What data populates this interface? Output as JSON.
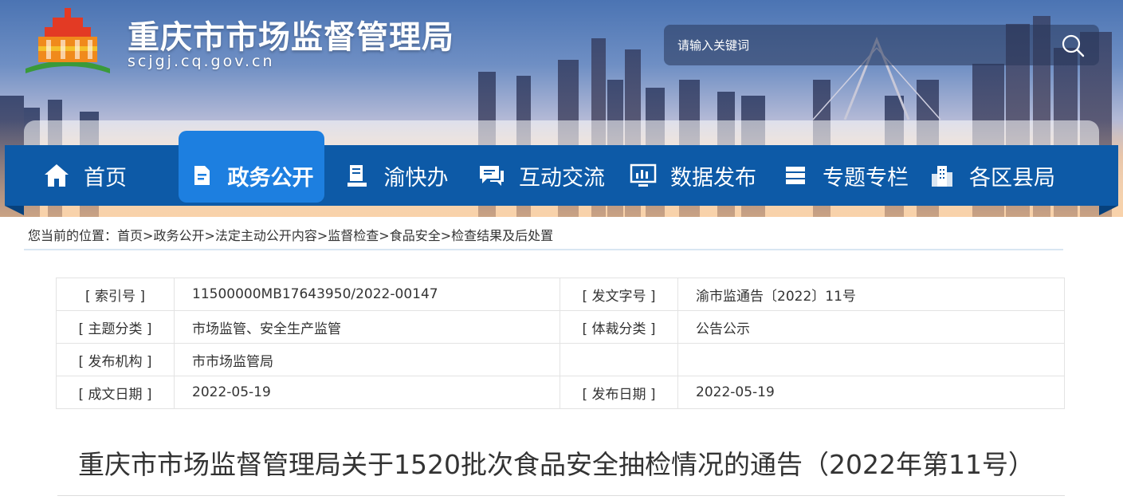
{
  "header": {
    "site_title": "重庆市市场监督管理局",
    "site_domain": "scjgj.cq.gov.cn",
    "search": {
      "placeholder": "请输入关键词",
      "icon": "search-icon"
    }
  },
  "nav": {
    "items": [
      {
        "label": "首页",
        "icon": "home-icon",
        "active": false
      },
      {
        "label": "政务公开",
        "icon": "document-icon",
        "active": true
      },
      {
        "label": "渝快办",
        "icon": "book-icon",
        "active": false
      },
      {
        "label": "互动交流",
        "icon": "chat-icon",
        "active": false
      },
      {
        "label": "数据发布",
        "icon": "monitor-chart-icon",
        "active": false
      },
      {
        "label": "专题专栏",
        "icon": "stack-icon",
        "active": false
      },
      {
        "label": "各区县局",
        "icon": "buildings-icon",
        "active": false
      }
    ]
  },
  "breadcrumb": {
    "prefix": "您当前的位置：",
    "items": [
      "首页",
      "政务公开",
      "法定主动公开内容",
      "监督检查",
      "食品安全",
      "检查结果及后处置"
    ],
    "separator": ">"
  },
  "meta": {
    "rows": [
      {
        "k1": "[ 索引号 ]",
        "v1": "11500000MB17643950/2022-00147",
        "k2": "[ 发文字号 ]",
        "v2": "渝市监通告〔2022〕11号"
      },
      {
        "k1": "[ 主题分类 ]",
        "v1": "市场监管、安全生产监管",
        "k2": "[ 体裁分类 ]",
        "v2": "公告公示"
      },
      {
        "k1": "[ 发布机构 ]",
        "v1": "市市场监管局",
        "k2": "",
        "v2": ""
      },
      {
        "k1": "[ 成文日期 ]",
        "v1": "2022-05-19",
        "k2": "[ 发布日期 ]",
        "v2": "2022-05-19"
      }
    ]
  },
  "article": {
    "title": "重庆市市场监督管理局关于1520批次食品安全抽检情况的通告（2022年第11号）"
  },
  "colors": {
    "nav_bg": "#0d5aa7",
    "nav_active": "#1d7fe0",
    "text": "#333333"
  }
}
